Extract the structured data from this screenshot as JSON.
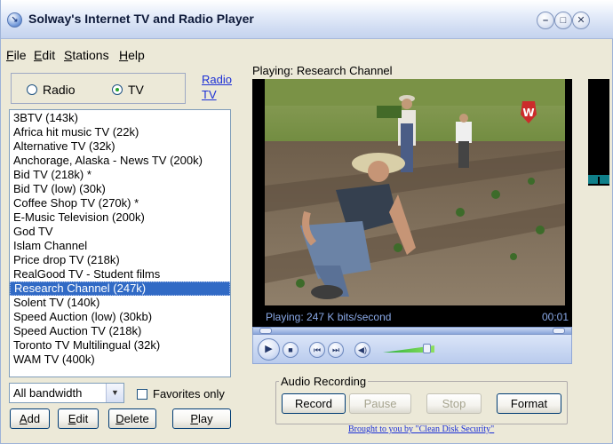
{
  "window": {
    "title": "Solway's Internet TV and Radio Player"
  },
  "menu": [
    {
      "label": "File",
      "underline": "F",
      "rest": "ile"
    },
    {
      "label": "Edit",
      "underline": "E",
      "rest": "dit"
    },
    {
      "label": "Stations",
      "underline": "S",
      "rest": "tations"
    },
    {
      "label": "Help",
      "underline": "H",
      "rest": "elp"
    }
  ],
  "mode": {
    "radio_label": "Radio",
    "tv_label": "TV",
    "selected": "TV",
    "link_radio": "Radio",
    "link_tv": "TV"
  },
  "stations": {
    "selected_index": 13,
    "items": [
      "3BTV  (143k)",
      "Africa hit music TV  (22k)",
      "Alternative TV  (32k)",
      "Anchorage, Alaska - News TV  (200k)",
      "Bid TV  (218k) *",
      "Bid TV (low)  (30k)",
      "Coffee Shop TV  (270k) *",
      "E-Music Television  (200k)",
      "God TV",
      "Islam Channel",
      "Price drop TV  (218k)",
      "RealGood TV - Student films",
      "Research Channel  (247k)",
      "Solent TV  (140k)",
      "Speed Auction (low)  (30kb)",
      "Speed Auction TV  (218k)",
      "Toronto TV Multilingual  (32k)",
      "WAM TV  (400k)"
    ]
  },
  "filters": {
    "bandwidth_value": "All bandwidth",
    "favorites_label": "Favorites only",
    "favorites_checked": false
  },
  "buttons": {
    "add": "Add",
    "add_u": "A",
    "add_rest": "dd",
    "edit": "Edit",
    "edit_u": "E",
    "edit_rest": "dit",
    "delete": "Delete",
    "delete_u": "D",
    "delete_rest": "elete",
    "play": "Play",
    "play_u": "P",
    "play_rest": "lay"
  },
  "player": {
    "now_playing": "Playing: Research Channel",
    "status_text": "Playing: 247 K bits/second",
    "time": "00:01",
    "volume_level": 0.85,
    "meter_level": 0.08
  },
  "recording": {
    "group_label": "Audio Recording",
    "record": "Record",
    "pause": "Pause",
    "stop": "Stop",
    "format": "Format"
  },
  "footer": {
    "credit": "Brought to you by \"Clean Disk Security\""
  },
  "colors": {
    "selection": "#316ac5",
    "link": "#1b2fd6",
    "panel": "#ece9d8",
    "status_text": "#89a8e6"
  }
}
